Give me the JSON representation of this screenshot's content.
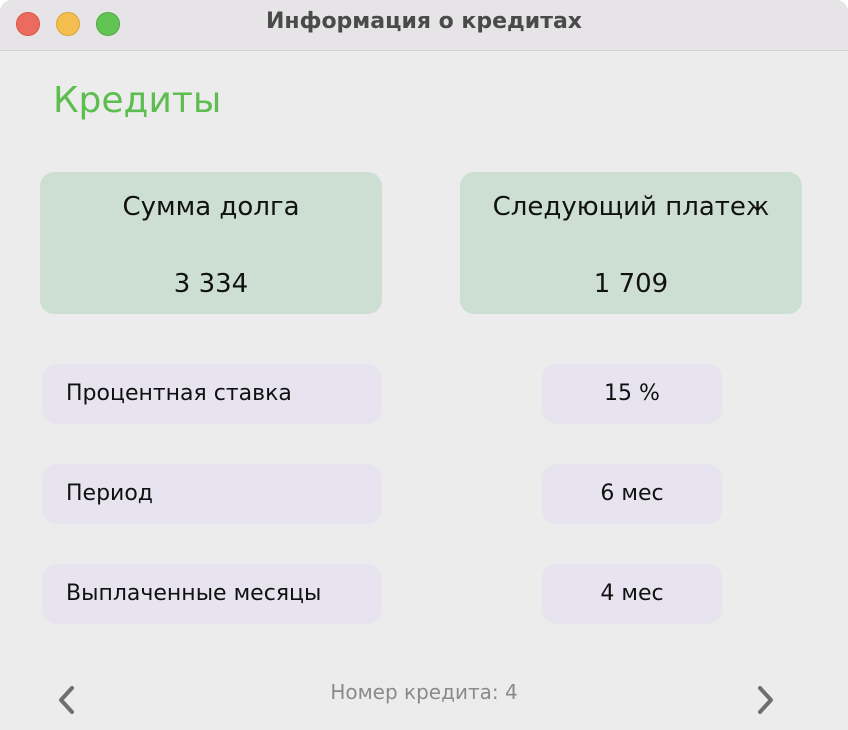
{
  "window": {
    "title": "Информация о кредитах"
  },
  "heading": "Кредиты",
  "cards": [
    {
      "title": "Сумма долга",
      "value": "3 334"
    },
    {
      "title": "Следующий платеж",
      "value": "1 709"
    }
  ],
  "details": [
    {
      "label": "Процентная ставка",
      "value": "15 %"
    },
    {
      "label": "Период",
      "value": "6 мес"
    },
    {
      "label": "Выплаченные месяцы",
      "value": "4 мес"
    }
  ],
  "footer": {
    "credit_number": "Номер кредита: 4"
  },
  "icons": {
    "prev": "chevron-left-icon",
    "next": "chevron-right-icon"
  },
  "colors": {
    "accent": "#5dbd4f",
    "card_bg": "#cddfd2",
    "pill_bg": "#e7e4f0"
  }
}
